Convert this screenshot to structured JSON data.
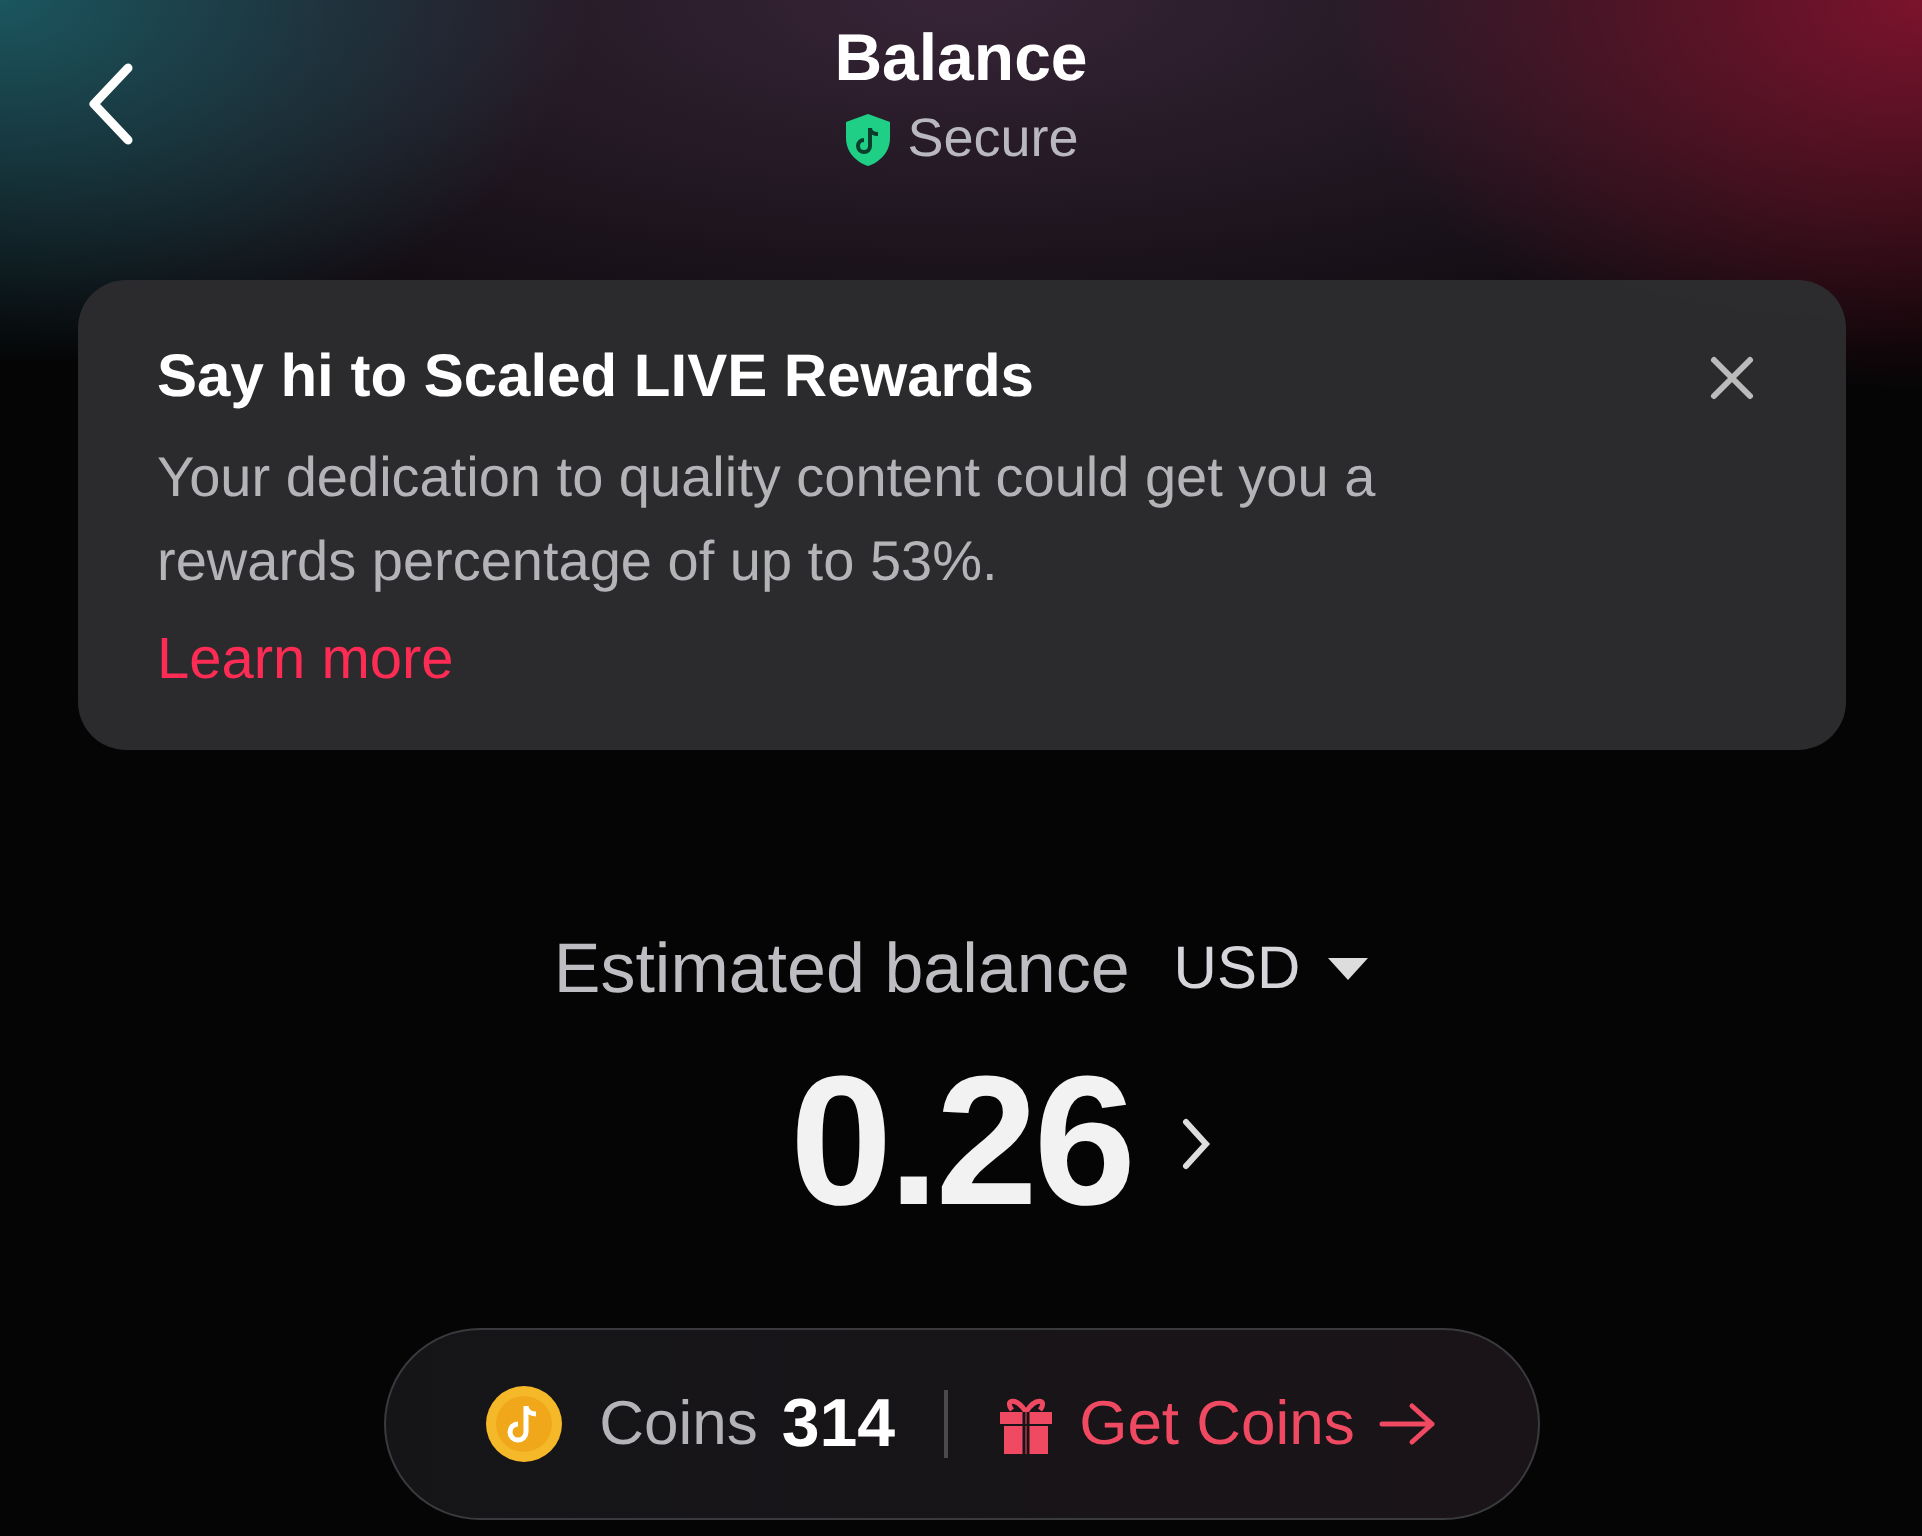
{
  "header": {
    "title": "Balance",
    "subtitle": "Secure"
  },
  "banner": {
    "title": "Say hi to Scaled LIVE Rewards",
    "body": "Your dedication to quality content could get you a rewards percentage of up to 53%.",
    "link": "Learn more"
  },
  "balance": {
    "label": "Estimated balance",
    "currency": "USD",
    "amount": "0.26"
  },
  "coins": {
    "label": "Coins",
    "count": "314",
    "action": "Get Coins"
  }
}
